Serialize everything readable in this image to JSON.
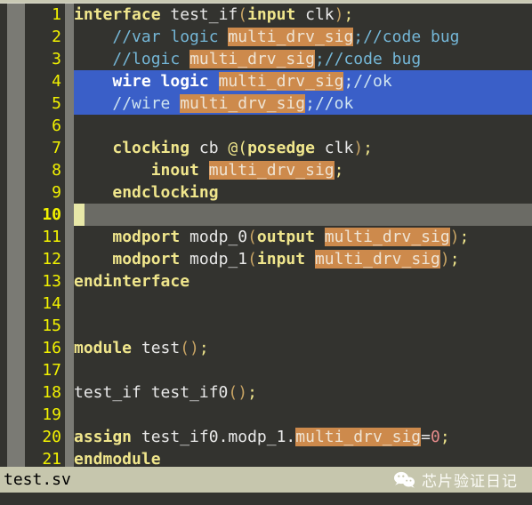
{
  "window": {
    "filename": "test.sv",
    "language": "systemverilog"
  },
  "theme": {
    "background": "#33332f",
    "gutter_number": "#f2f200",
    "keyword": "#f0e68c",
    "identifier": "#e8e8e8",
    "comment": "#74b6d6",
    "search_highlight_bg": "#cd8a4c",
    "selection_bg": "#3a5fc8",
    "current_line_bg": "#6b6b65",
    "cursor_block": "#e8e8a8",
    "number": "#e48a8a",
    "paren": "#c8a464",
    "statusbar_bg": "#c6c6ad",
    "statusbar_fg": "#000000"
  },
  "search_term": "multi_drv_sig",
  "statusbar": {
    "file_label": "test.sv",
    "watermark_text": "芯片验证日记",
    "watermark_icon": "wechat-icon"
  },
  "lines": [
    {
      "n": "1",
      "selected": false,
      "current": false,
      "tokens": [
        {
          "t": "interface",
          "c": "kw"
        },
        {
          "t": " ",
          "c": "id"
        },
        {
          "t": "test_if",
          "c": "id"
        },
        {
          "t": "(",
          "c": "paren"
        },
        {
          "t": "input",
          "c": "kw"
        },
        {
          "t": " clk",
          "c": "id"
        },
        {
          "t": ")",
          "c": "paren"
        },
        {
          "t": ";",
          "c": "kw2"
        }
      ]
    },
    {
      "n": "2",
      "selected": false,
      "current": false,
      "tokens": [
        {
          "t": "    ",
          "c": "id"
        },
        {
          "t": "//var logic ",
          "c": "cmt"
        },
        {
          "t": "multi_drv_sig",
          "c": "hl"
        },
        {
          "t": ";//code bug",
          "c": "cmt"
        }
      ]
    },
    {
      "n": "3",
      "selected": false,
      "current": false,
      "tokens": [
        {
          "t": "    ",
          "c": "id"
        },
        {
          "t": "//logic ",
          "c": "cmt"
        },
        {
          "t": "multi_drv_sig",
          "c": "hl"
        },
        {
          "t": ";//code bug",
          "c": "cmt"
        }
      ]
    },
    {
      "n": "4",
      "selected": true,
      "current": false,
      "tokens": [
        {
          "t": "    ",
          "c": "seln"
        },
        {
          "t": "wire logic",
          "c": "selw"
        },
        {
          "t": " ",
          "c": "seln"
        },
        {
          "t": "multi_drv_sig",
          "c": "hl"
        },
        {
          "t": ";//ok",
          "c": "selc"
        }
      ]
    },
    {
      "n": "5",
      "selected": true,
      "current": false,
      "tokens": [
        {
          "t": "    ",
          "c": "seln"
        },
        {
          "t": "//wire ",
          "c": "selc"
        },
        {
          "t": "multi_drv_sig",
          "c": "hl"
        },
        {
          "t": ";//ok",
          "c": "selc"
        }
      ]
    },
    {
      "n": "6",
      "selected": false,
      "current": false,
      "tokens": []
    },
    {
      "n": "7",
      "selected": false,
      "current": false,
      "tokens": [
        {
          "t": "    ",
          "c": "id"
        },
        {
          "t": "clocking",
          "c": "kw"
        },
        {
          "t": " cb ",
          "c": "id"
        },
        {
          "t": "@(",
          "c": "kw2"
        },
        {
          "t": "posedge",
          "c": "kw"
        },
        {
          "t": " clk",
          "c": "id"
        },
        {
          "t": ")",
          "c": "paren"
        },
        {
          "t": ";",
          "c": "kw2"
        }
      ]
    },
    {
      "n": "8",
      "selected": false,
      "current": false,
      "tokens": [
        {
          "t": "        ",
          "c": "id"
        },
        {
          "t": "inout",
          "c": "kw"
        },
        {
          "t": " ",
          "c": "id"
        },
        {
          "t": "multi_drv_sig",
          "c": "hl"
        },
        {
          "t": ";",
          "c": "kw2"
        }
      ]
    },
    {
      "n": "9",
      "selected": false,
      "current": false,
      "tokens": [
        {
          "t": "    ",
          "c": "id"
        },
        {
          "t": "endclocking",
          "c": "kw"
        }
      ]
    },
    {
      "n": "10",
      "selected": false,
      "current": true,
      "tokens": []
    },
    {
      "n": "11",
      "selected": false,
      "current": false,
      "tokens": [
        {
          "t": "    ",
          "c": "id"
        },
        {
          "t": "modport",
          "c": "kw"
        },
        {
          "t": " modp_0",
          "c": "id"
        },
        {
          "t": "(",
          "c": "paren"
        },
        {
          "t": "output",
          "c": "kw"
        },
        {
          "t": " ",
          "c": "id"
        },
        {
          "t": "multi_drv_sig",
          "c": "hl"
        },
        {
          "t": ")",
          "c": "paren"
        },
        {
          "t": ";",
          "c": "kw2"
        }
      ]
    },
    {
      "n": "12",
      "selected": false,
      "current": false,
      "tokens": [
        {
          "t": "    ",
          "c": "id"
        },
        {
          "t": "modport",
          "c": "kw"
        },
        {
          "t": " modp_1",
          "c": "id"
        },
        {
          "t": "(",
          "c": "paren"
        },
        {
          "t": "input",
          "c": "kw"
        },
        {
          "t": " ",
          "c": "id"
        },
        {
          "t": "multi_drv_sig",
          "c": "hl"
        },
        {
          "t": ")",
          "c": "paren"
        },
        {
          "t": ";",
          "c": "kw2"
        }
      ]
    },
    {
      "n": "13",
      "selected": false,
      "current": false,
      "tokens": [
        {
          "t": "endinterface",
          "c": "kw"
        }
      ]
    },
    {
      "n": "14",
      "selected": false,
      "current": false,
      "tokens": []
    },
    {
      "n": "15",
      "selected": false,
      "current": false,
      "tokens": []
    },
    {
      "n": "16",
      "selected": false,
      "current": false,
      "tokens": [
        {
          "t": "module",
          "c": "kw"
        },
        {
          "t": " test",
          "c": "id"
        },
        {
          "t": "()",
          "c": "paren"
        },
        {
          "t": ";",
          "c": "kw2"
        }
      ]
    },
    {
      "n": "17",
      "selected": false,
      "current": false,
      "tokens": []
    },
    {
      "n": "18",
      "selected": false,
      "current": false,
      "tokens": [
        {
          "t": "test_if test_if0",
          "c": "id"
        },
        {
          "t": "()",
          "c": "paren"
        },
        {
          "t": ";",
          "c": "kw2"
        }
      ]
    },
    {
      "n": "19",
      "selected": false,
      "current": false,
      "tokens": []
    },
    {
      "n": "20",
      "selected": false,
      "current": false,
      "tokens": [
        {
          "t": "assign",
          "c": "kw"
        },
        {
          "t": " test_if0.modp_1.",
          "c": "id"
        },
        {
          "t": "multi_drv_sig",
          "c": "hl"
        },
        {
          "t": "=",
          "c": "id"
        },
        {
          "t": "0",
          "c": "num"
        },
        {
          "t": ";",
          "c": "kw2"
        }
      ]
    },
    {
      "n": "21",
      "selected": false,
      "current": false,
      "tokens": [
        {
          "t": "endmodule",
          "c": "kw"
        }
      ]
    }
  ]
}
